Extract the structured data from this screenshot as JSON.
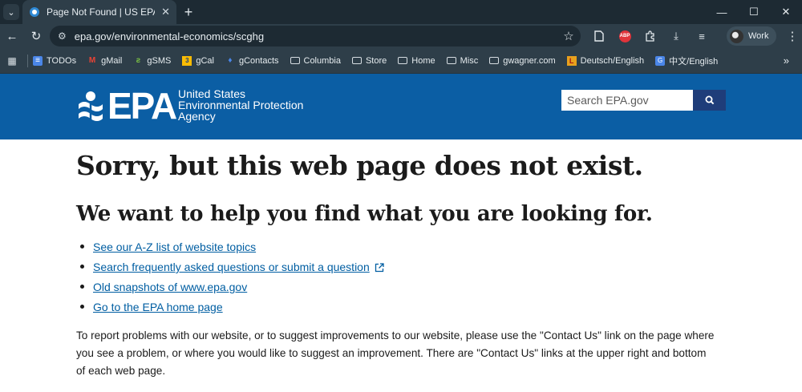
{
  "browser": {
    "tab_title": "Page Not Found | US EPA",
    "url": "epa.gov/environmental-economics/scghg",
    "profile_name": "Work",
    "adblock_label": "ABP",
    "bookmarks": [
      {
        "label": "TODOs",
        "icon": "doc-icon"
      },
      {
        "label": "gMail",
        "icon": "gmail-icon"
      },
      {
        "label": "gSMS",
        "icon": "sms-icon"
      },
      {
        "label": "gCal",
        "icon": "calendar-icon"
      },
      {
        "label": "gContacts",
        "icon": "contacts-icon"
      },
      {
        "label": "Columbia",
        "icon": "folder-icon"
      },
      {
        "label": "Store",
        "icon": "folder-icon"
      },
      {
        "label": "Home",
        "icon": "folder-icon"
      },
      {
        "label": "Misc",
        "icon": "folder-icon"
      },
      {
        "label": "gwagner.com",
        "icon": "folder-icon"
      },
      {
        "label": "Deutsch/English",
        "icon": "dictionary-icon"
      },
      {
        "label": "中文/English",
        "icon": "translate-icon"
      }
    ]
  },
  "header": {
    "logo_text": "EPA",
    "agency_line1": "United States",
    "agency_line2": "Environmental Protection",
    "agency_line3": "Agency",
    "search_placeholder": "Search EPA.gov",
    "brand_color": "#0b5ea4"
  },
  "main": {
    "title": "Sorry, but this web page does not exist.",
    "subtitle": "We want to help you find what you are looking for.",
    "links": [
      "See our A-Z list of website topics",
      "Search frequently asked questions or submit a question",
      "Old snapshots of www.epa.gov",
      "Go to the EPA home page"
    ],
    "report_text": "To report problems with our website, or to suggest improvements to our website, please use the \"Contact Us\" link on the page where you see a problem, or where you would like to suggest an improvement. There are \"Contact Us\" links at the upper right and bottom of each web page."
  }
}
